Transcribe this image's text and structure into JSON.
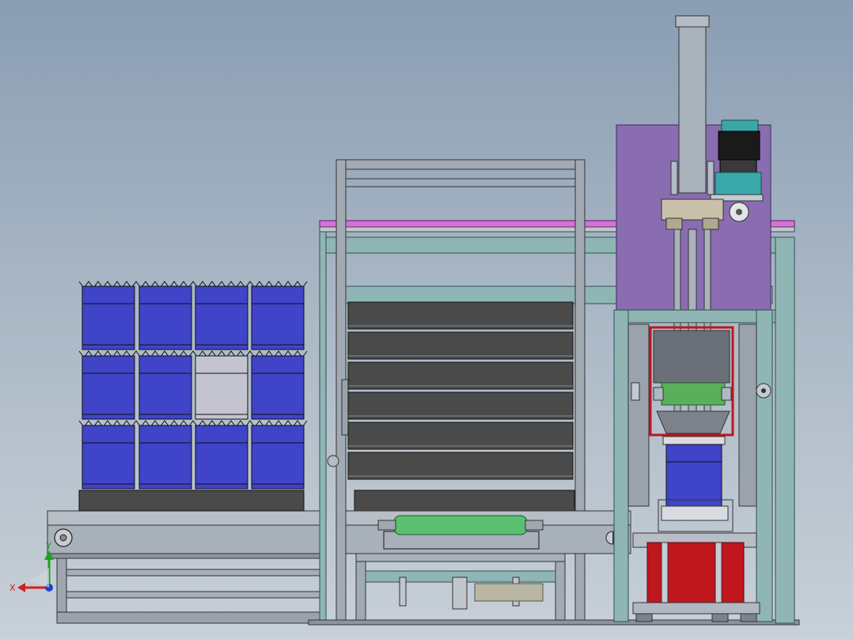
{
  "viewport": {
    "axis_triad": {
      "x_label": "X",
      "y_label": "Y"
    }
  },
  "colors": {
    "background_top": "#8a9db3",
    "background_bottom": "#c8d0d8",
    "frame_teal": "#8fb5b5",
    "drum_blue": "#3f44c8",
    "drum_silver": "#c4c4d0",
    "panel_purple": "#8a6db0",
    "rail_magenta": "#d870d8",
    "stand_red": "#c0161e",
    "roller_green": "#58c070",
    "block_green": "#5ab05a",
    "motor_teal": "#3aa8a8",
    "conveyor_gray": "#9ea6b0",
    "pallet_dark": "#4a4a4a",
    "axis_x": "#d02020",
    "axis_y": "#20a020",
    "axis_z": "#2040d0"
  },
  "drum_stack": {
    "columns": 4,
    "rows": 3,
    "highlighted": {
      "row": 1,
      "column": 2,
      "color": "drum_silver"
    }
  },
  "pallet_magazine": {
    "pallets": 6
  }
}
